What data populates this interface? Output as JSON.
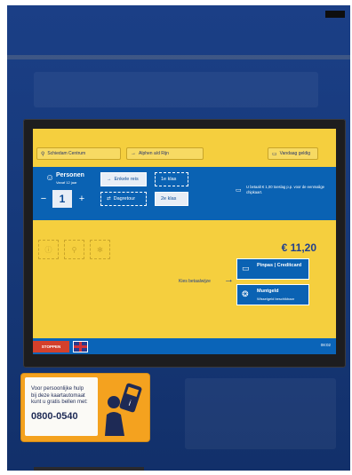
{
  "screen": {
    "topbar": {
      "from_station": "Schiedam Centrum",
      "to_station": "Alphen a/d Rijn",
      "validity": "Vandaag geldig"
    },
    "persons": {
      "label": "Personen",
      "sublabel": "Vanaf 12 jaar",
      "count": "1",
      "minus": "−",
      "plus": "+"
    },
    "trip_options": [
      "Enkele reis",
      "Dagretour"
    ],
    "class_options": [
      "1e klas",
      "2e klas"
    ],
    "notice": "U betaalt € 1,00 toeslag p.p. voor de eenmalige chipkaart.",
    "price": "€ 11,20",
    "payment": {
      "prompt": "Kies betaalwijze",
      "card_label": "Pinpas | Creditcard",
      "coin_label": "Muntgeld",
      "coin_sub": "Wisselgeld beschikbaar"
    },
    "bottombar": {
      "stop": "STOPPEN",
      "time": "08:02"
    }
  },
  "sticker": {
    "line1": "Voor persoonlijke hulp",
    "line2": "bij deze kaartautomaat",
    "line3": "kunt u gratis bellen met:",
    "phone": "0800-0540"
  },
  "colors": {
    "screen_yellow": "#f5cf3e",
    "ns_blue": "#0a62b3",
    "stop_red": "#d4402b",
    "machine_blue": "#173a7c",
    "sticker_orange": "#f4a21f"
  }
}
